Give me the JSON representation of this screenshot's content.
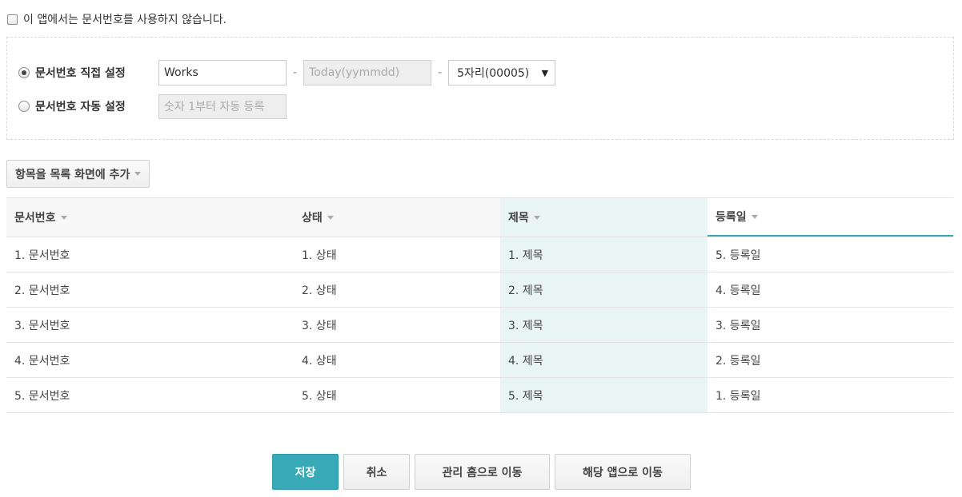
{
  "top_checkbox": {
    "label": "이 앱에서는 문서번호를 사용하지 않습니다.",
    "checked": false
  },
  "settings": {
    "manual": {
      "label": "문서번호 직접 설정",
      "selected": true,
      "prefix_value": "Works",
      "date_placeholder": "Today(yymmdd)",
      "separator": "-",
      "digits_selected": "5자리(00005)"
    },
    "auto": {
      "label": "문서번호 자동 설정",
      "selected": false,
      "placeholder": "숫자 1부터 자동 등록"
    }
  },
  "add_column_button": {
    "label": "항목을 목록 화면에 추가"
  },
  "table": {
    "columns": [
      {
        "label": "문서번호"
      },
      {
        "label": "상태"
      },
      {
        "label": "제목"
      },
      {
        "label": "등록일"
      }
    ],
    "rows": [
      [
        "1. 문서번호",
        "1. 상태",
        "1. 제목",
        "5. 등록일"
      ],
      [
        "2. 문서번호",
        "2. 상태",
        "2. 제목",
        "4. 등록일"
      ],
      [
        "3. 문서번호",
        "3. 상태",
        "3. 제목",
        "3. 등록일"
      ],
      [
        "4. 문서번호",
        "4. 상태",
        "4. 제목",
        "2. 등록일"
      ],
      [
        "5. 문서번호",
        "5. 상태",
        "5. 제목",
        "1. 등록일"
      ]
    ]
  },
  "actions": {
    "save": "저장",
    "cancel": "취소",
    "go_admin_home": "관리 홈으로 이동",
    "go_app": "해당 앱으로 이동"
  },
  "colors": {
    "accent": "#37a9b7",
    "highlight_column": "#e9f4f5"
  }
}
